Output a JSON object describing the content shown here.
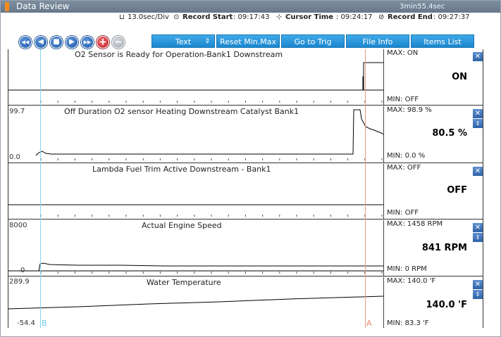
{
  "window": {
    "title": "Data Review",
    "elapsed": "3min55.4sec"
  },
  "infobar": {
    "div": "13.0sec/Div",
    "record_start_label": "Record Start",
    "record_start": ": 09:17:43",
    "cursor_time_label": "Cursor Time",
    "cursor_time": ": 09:24:17",
    "record_end_label": "Record End",
    "record_end": ": 09:27:37"
  },
  "toolbar": {
    "round_buttons": [
      {
        "icon": "rewind-fast-icon",
        "glyph": "◀◀"
      },
      {
        "icon": "rewind-icon",
        "glyph": "◀"
      },
      {
        "icon": "stop-icon",
        "glyph": "■"
      },
      {
        "icon": "play-icon",
        "glyph": "▶"
      },
      {
        "icon": "fast-forward-icon",
        "glyph": "▶▶"
      },
      {
        "icon": "zoom-in-icon",
        "glyph": "+"
      },
      {
        "icon": "zoom-out-icon",
        "glyph": "−"
      }
    ],
    "text_select": "Text",
    "text_select_arrow": "⇕",
    "reset_minmax": "Reset Min.Max",
    "go_to_trig": "Go to Trig",
    "file_info": "File Info",
    "items_list": "Items List"
  },
  "cursors": {
    "b_label": "B",
    "a_label": "A"
  },
  "panels": [
    {
      "title": "O2 Sensor is Ready for Operation-Bank1 Downstream",
      "y_max": "",
      "y_min": "",
      "max": "MAX: ON",
      "current": "ON",
      "min": "MIN: OFF",
      "has_scroll": false
    },
    {
      "title": "Off Duration O2 sensor Heating Downstream Catalyst Bank1",
      "y_max": "99.7",
      "y_min": "0.0",
      "max": "MAX:  98.9 %",
      "current": "80.5 %",
      "min": "MIN:   0.0 %",
      "has_scroll": true
    },
    {
      "title": "Lambda Fuel Trim Active Downstream - Bank1",
      "y_max": "",
      "y_min": "",
      "max": "MAX: OFF",
      "current": "OFF",
      "min": "MIN: OFF",
      "has_scroll": false
    },
    {
      "title": "Actual Engine Speed",
      "y_max": "8000",
      "y_min": "0",
      "max": "MAX:  1458 RPM",
      "current": "841 RPM",
      "min": "MIN:     0 RPM",
      "has_scroll": true
    },
    {
      "title": "Water Temperature",
      "y_max": "289.9",
      "y_min": "-54.4",
      "max": "MAX: 140.0 'F",
      "current": "140.0 'F",
      "min": "MIN:  83.3 'F",
      "has_scroll": true
    }
  ],
  "close_glyph": "✕",
  "scroll_glyph": "⇕",
  "colors": {
    "cursor_b": "#7fd9f0",
    "cursor_a": "#e79a86",
    "accent": "#1b86cf"
  }
}
